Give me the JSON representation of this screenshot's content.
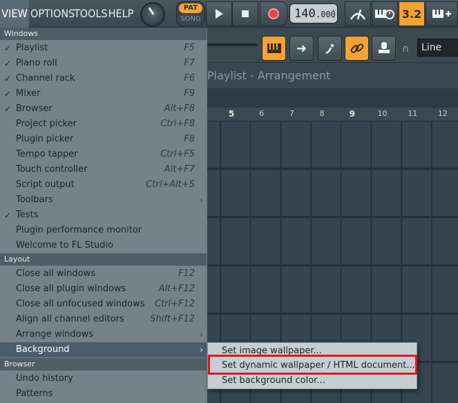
{
  "menubar": {
    "view": "VIEW",
    "options": "OPTIONS",
    "tools": "TOOLS",
    "help": "HELP"
  },
  "transport": {
    "pat": "PAT",
    "song": "SONG",
    "tempo_int": "140",
    "tempo_dec": ".000",
    "countdown": "3.2"
  },
  "toolbar2": {
    "snap_value": "Line"
  },
  "playlist": {
    "title": "Playlist - Arrangement",
    "pattern": "(none)",
    "bar_numbers": [
      "5",
      "6",
      "7",
      "8",
      "9",
      "10",
      "11",
      "12"
    ]
  },
  "view_menu": {
    "sections": {
      "windows": "Windows",
      "layout": "Layout",
      "browser": "Browser"
    },
    "windows_items": [
      {
        "label": "Playlist",
        "shortcut": "F5",
        "checked": true
      },
      {
        "label": "Piano roll",
        "shortcut": "F7",
        "checked": true
      },
      {
        "label": "Channel rack",
        "shortcut": "F6",
        "checked": true
      },
      {
        "label": "Mixer",
        "shortcut": "F9",
        "checked": true
      },
      {
        "label": "Browser",
        "shortcut": "Alt+F8",
        "checked": true
      },
      {
        "label": "Project picker",
        "shortcut": "Ctrl+F8",
        "checked": false
      },
      {
        "label": "Plugin picker",
        "shortcut": "F8",
        "checked": false
      },
      {
        "label": "Tempo tapper",
        "shortcut": "Ctrl+F5",
        "checked": false
      },
      {
        "label": "Touch controller",
        "shortcut": "Alt+F7",
        "checked": false
      },
      {
        "label": "Script output",
        "shortcut": "Ctrl+Alt+S",
        "checked": false
      },
      {
        "label": "Toolbars",
        "shortcut": "",
        "checked": false,
        "submenu": true
      },
      {
        "label": "Tests",
        "shortcut": "",
        "checked": true
      },
      {
        "label": "Plugin performance monitor",
        "shortcut": "",
        "checked": false
      },
      {
        "label": "Welcome to FL Studio",
        "shortcut": "",
        "checked": false
      }
    ],
    "layout_items": [
      {
        "label": "Close all windows",
        "shortcut": "F12"
      },
      {
        "label": "Close all plugin windows",
        "shortcut": "Alt+F12"
      },
      {
        "label": "Close all unfocused windows",
        "shortcut": "Ctrl+F12"
      },
      {
        "label": "Align all channel editors",
        "shortcut": "Shift+F12"
      },
      {
        "label": "Arrange windows",
        "shortcut": "",
        "submenu": true
      },
      {
        "label": "Background",
        "shortcut": "",
        "submenu": true,
        "highlighted": true
      }
    ],
    "browser_items": [
      {
        "label": "Undo history"
      },
      {
        "label": "Patterns"
      }
    ],
    "check_glyph": "✓",
    "arrow_glyph": "›"
  },
  "background_submenu": [
    {
      "label": "Set image wallpaper..."
    },
    {
      "label": "Set dynamic wallpaper / HTML document..."
    },
    {
      "label": "Set background color..."
    }
  ]
}
